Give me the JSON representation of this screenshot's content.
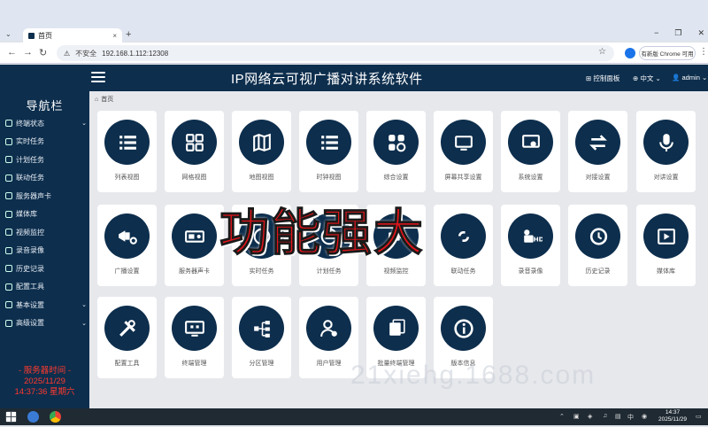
{
  "browser": {
    "tab_title": "首页",
    "tab_close": "×",
    "new_tab": "+",
    "url": "192.168.1.112:12308",
    "security": "不安全",
    "update_button": "有新版 Chrome 可用",
    "window_controls": [
      "−",
      "❐",
      "✕"
    ]
  },
  "app": {
    "title": "IP网络云可视广播对讲系统软件",
    "header_links": {
      "dashboard": "控制面板",
      "language": "中文",
      "user": "admin"
    },
    "breadcrumb": "首页"
  },
  "sidebar": {
    "title": "导航栏",
    "items": [
      {
        "label": "终端状态",
        "chevron": "⌄",
        "icon": "terminal-status-icon"
      },
      {
        "label": "实时任务",
        "chevron": "",
        "icon": "realtime-task-icon"
      },
      {
        "label": "计划任务",
        "chevron": "",
        "icon": "plan-task-icon"
      },
      {
        "label": "联动任务",
        "chevron": "",
        "icon": "linkage-task-icon"
      },
      {
        "label": "服务器声卡",
        "chevron": "",
        "icon": "soundcard-icon"
      },
      {
        "label": "媒体库",
        "chevron": "",
        "icon": "media-library-icon"
      },
      {
        "label": "视频监控",
        "chevron": "",
        "icon": "video-monitor-icon"
      },
      {
        "label": "录音录像",
        "chevron": "",
        "icon": "record-icon"
      },
      {
        "label": "历史记录",
        "chevron": "",
        "icon": "history-icon"
      },
      {
        "label": "配置工具",
        "chevron": "",
        "icon": "config-tool-icon"
      },
      {
        "label": "基本设置",
        "chevron": "⌄",
        "icon": "basic-settings-icon"
      },
      {
        "label": "高级设置",
        "chevron": "⌄",
        "icon": "advanced-settings-icon"
      }
    ],
    "server_time_label": "- 服务器时间 -",
    "server_date": "2025/11/29",
    "server_time": "14:37:36 星期六"
  },
  "tiles": [
    {
      "label": "列表视图",
      "icon": "list-view-icon"
    },
    {
      "label": "网格视图",
      "icon": "grid-view-icon"
    },
    {
      "label": "地图视图",
      "icon": "map-view-icon"
    },
    {
      "label": "时钟视图",
      "icon": "clock-view-icon"
    },
    {
      "label": "综合设置",
      "icon": "general-settings-icon"
    },
    {
      "label": "屏幕共享设置",
      "icon": "screen-share-icon"
    },
    {
      "label": "系统设置",
      "icon": "system-settings-icon"
    },
    {
      "label": "对接设置",
      "icon": "docking-settings-icon"
    },
    {
      "label": "对讲设置",
      "icon": "intercom-settings-icon"
    },
    {
      "label": "广播设置",
      "icon": "broadcast-settings-icon"
    },
    {
      "label": "服务器声卡",
      "icon": "server-soundcard-icon"
    },
    {
      "label": "实时任务",
      "icon": "realtime-task-icon"
    },
    {
      "label": "计划任务",
      "icon": "plan-task-icon"
    },
    {
      "label": "视频监控",
      "icon": "video-monitor-icon"
    },
    {
      "label": "联动任务",
      "icon": "linkage-task-icon"
    },
    {
      "label": "录音录像",
      "icon": "record-video-icon"
    },
    {
      "label": "历史记录",
      "icon": "history-icon"
    },
    {
      "label": "媒体库",
      "icon": "media-library-icon"
    },
    {
      "label": "配置工具",
      "icon": "config-tools-icon"
    },
    {
      "label": "终端管理",
      "icon": "terminal-manage-icon"
    },
    {
      "label": "分区管理",
      "icon": "zone-manage-icon"
    },
    {
      "label": "用户管理",
      "icon": "user-manage-icon"
    },
    {
      "label": "批量终端管理",
      "icon": "batch-terminal-icon"
    },
    {
      "label": "版本信息",
      "icon": "version-info-icon"
    }
  ],
  "overlay": {
    "banner": "功能强大",
    "watermark": "21xiehg.1688.com"
  },
  "taskbar": {
    "lang": "中",
    "time": "14:37",
    "date": "2025/11/29"
  }
}
